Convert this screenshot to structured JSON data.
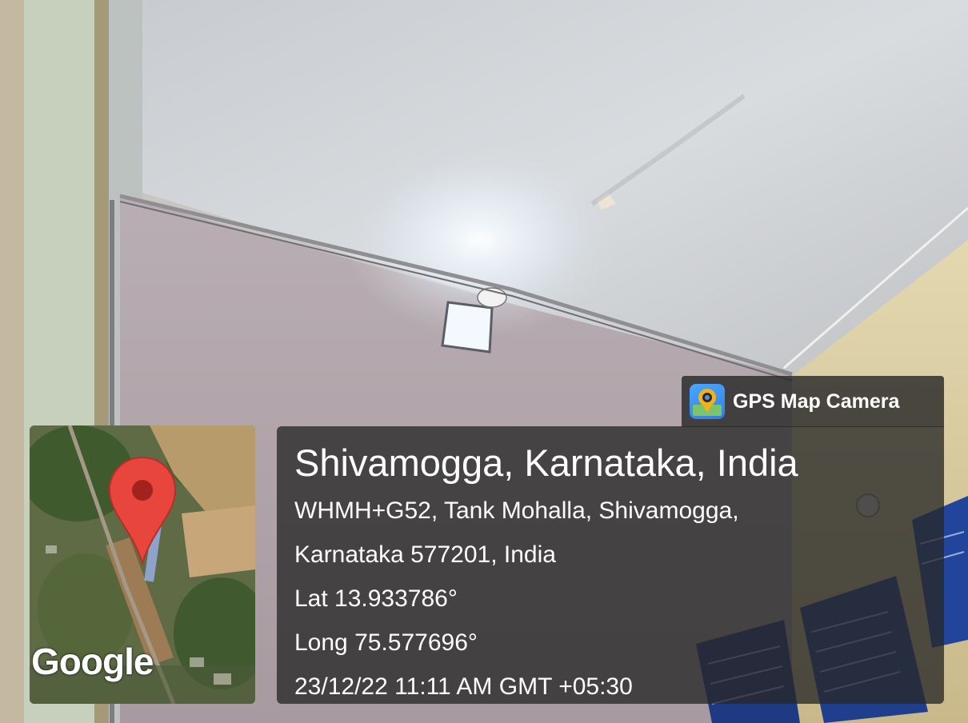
{
  "watermark": {
    "app_name": "GPS Map Camera",
    "icon": "gps-map-camera-app-icon",
    "accent": "#3d8ff0"
  },
  "map": {
    "logo_text": "Google",
    "pin_icon": "map-pin-icon",
    "pin_color": "#e8453c"
  },
  "location": {
    "title": "Shivamogga, Karnataka, India",
    "address_line_1": "WHMH+G52, Tank Mohalla, Shivamogga,",
    "address_line_2": "Karnataka 577201, India",
    "latitude": "Lat 13.933786°",
    "longitude": "Long 75.577696°",
    "datetime": "23/12/22 11:11 AM GMT +05:30"
  },
  "colors": {
    "overlay_bg": "#282828",
    "text": "#ffffff"
  }
}
